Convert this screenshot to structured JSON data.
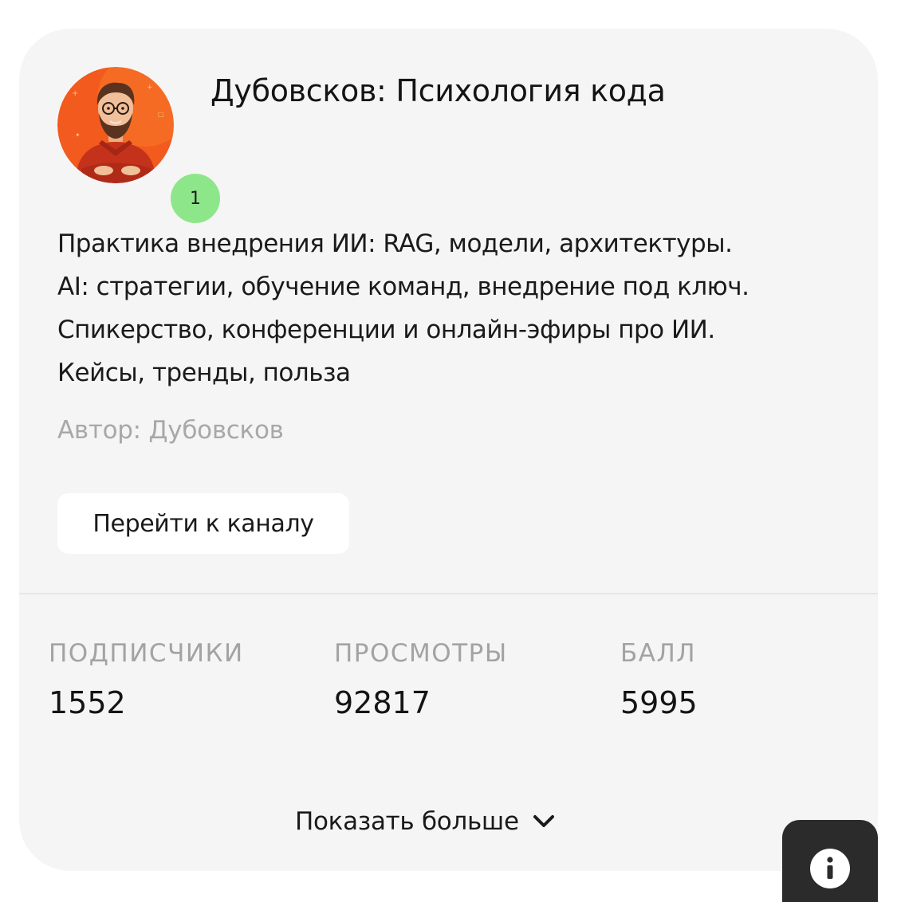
{
  "channel": {
    "title": "Дубовсков: Психология кода",
    "badge_count": "1",
    "description_lines": [
      "Практика внедрения ИИ: RAG, модели, архитектуры.",
      "AI: стратегии, обучение команд, внедрение под ключ.",
      "Спикерство, конференции и онлайн-эфиры про ИИ.",
      "Кейсы, тренды, польза"
    ],
    "author": "Автор: Дубовсков",
    "go_button_label": "Перейти к каналу"
  },
  "stats": [
    {
      "label": "ПОДПИСЧИКИ",
      "value": "1552"
    },
    {
      "label": "ПРОСМОТРЫ",
      "value": "92817"
    },
    {
      "label": "БАЛЛ",
      "value": "5995"
    }
  ],
  "show_more_label": "Показать больше",
  "icons": {
    "avatar": "avatar-illustration",
    "show_more": "chevron-down-icon",
    "info": "info-icon"
  },
  "colors": {
    "card_background": "#f5f5f5",
    "badge": "#8ee68a",
    "avatar_background": "#f25a1e",
    "info_button": "#2b2b2b"
  }
}
